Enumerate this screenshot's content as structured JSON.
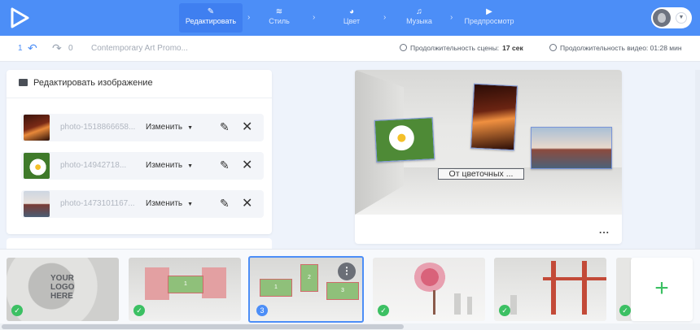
{
  "steps": [
    {
      "label": "Редактировать",
      "icon": "pencil-icon"
    },
    {
      "label": "Стиль",
      "icon": "layers-icon"
    },
    {
      "label": "Цвет",
      "icon": "palette-icon"
    },
    {
      "label": "Музыка",
      "icon": "music-note-icon"
    },
    {
      "label": "Предпросмотр",
      "icon": "play-icon"
    }
  ],
  "toolbar": {
    "undo_count": "1",
    "redo_count": "0",
    "project_title": "Contemporary Art Promo...",
    "scene_duration_label": "Продолжительность сцены:",
    "scene_duration_value": "17 сек",
    "video_duration_label": "Продолжительность видео: 01:28 мин"
  },
  "panel": {
    "title": "Редактировать изображение",
    "rows": [
      {
        "filename": "photo-1518866658...",
        "action": "Изменить"
      },
      {
        "filename": "photo-14942718...",
        "action": "Изменить"
      },
      {
        "filename": "photo-1473101167...",
        "action": "Изменить"
      }
    ]
  },
  "preview": {
    "caption": "От цветочных ...",
    "more": "..."
  },
  "timeline": {
    "logo_text": "YOUR LOGO HERE",
    "slide2_card": "1",
    "slide3_cards": [
      "1",
      "2",
      "3"
    ],
    "selected_number": "3",
    "add": "+"
  },
  "colors": {
    "accent": "#4c8ef7",
    "success": "#3cc063"
  }
}
